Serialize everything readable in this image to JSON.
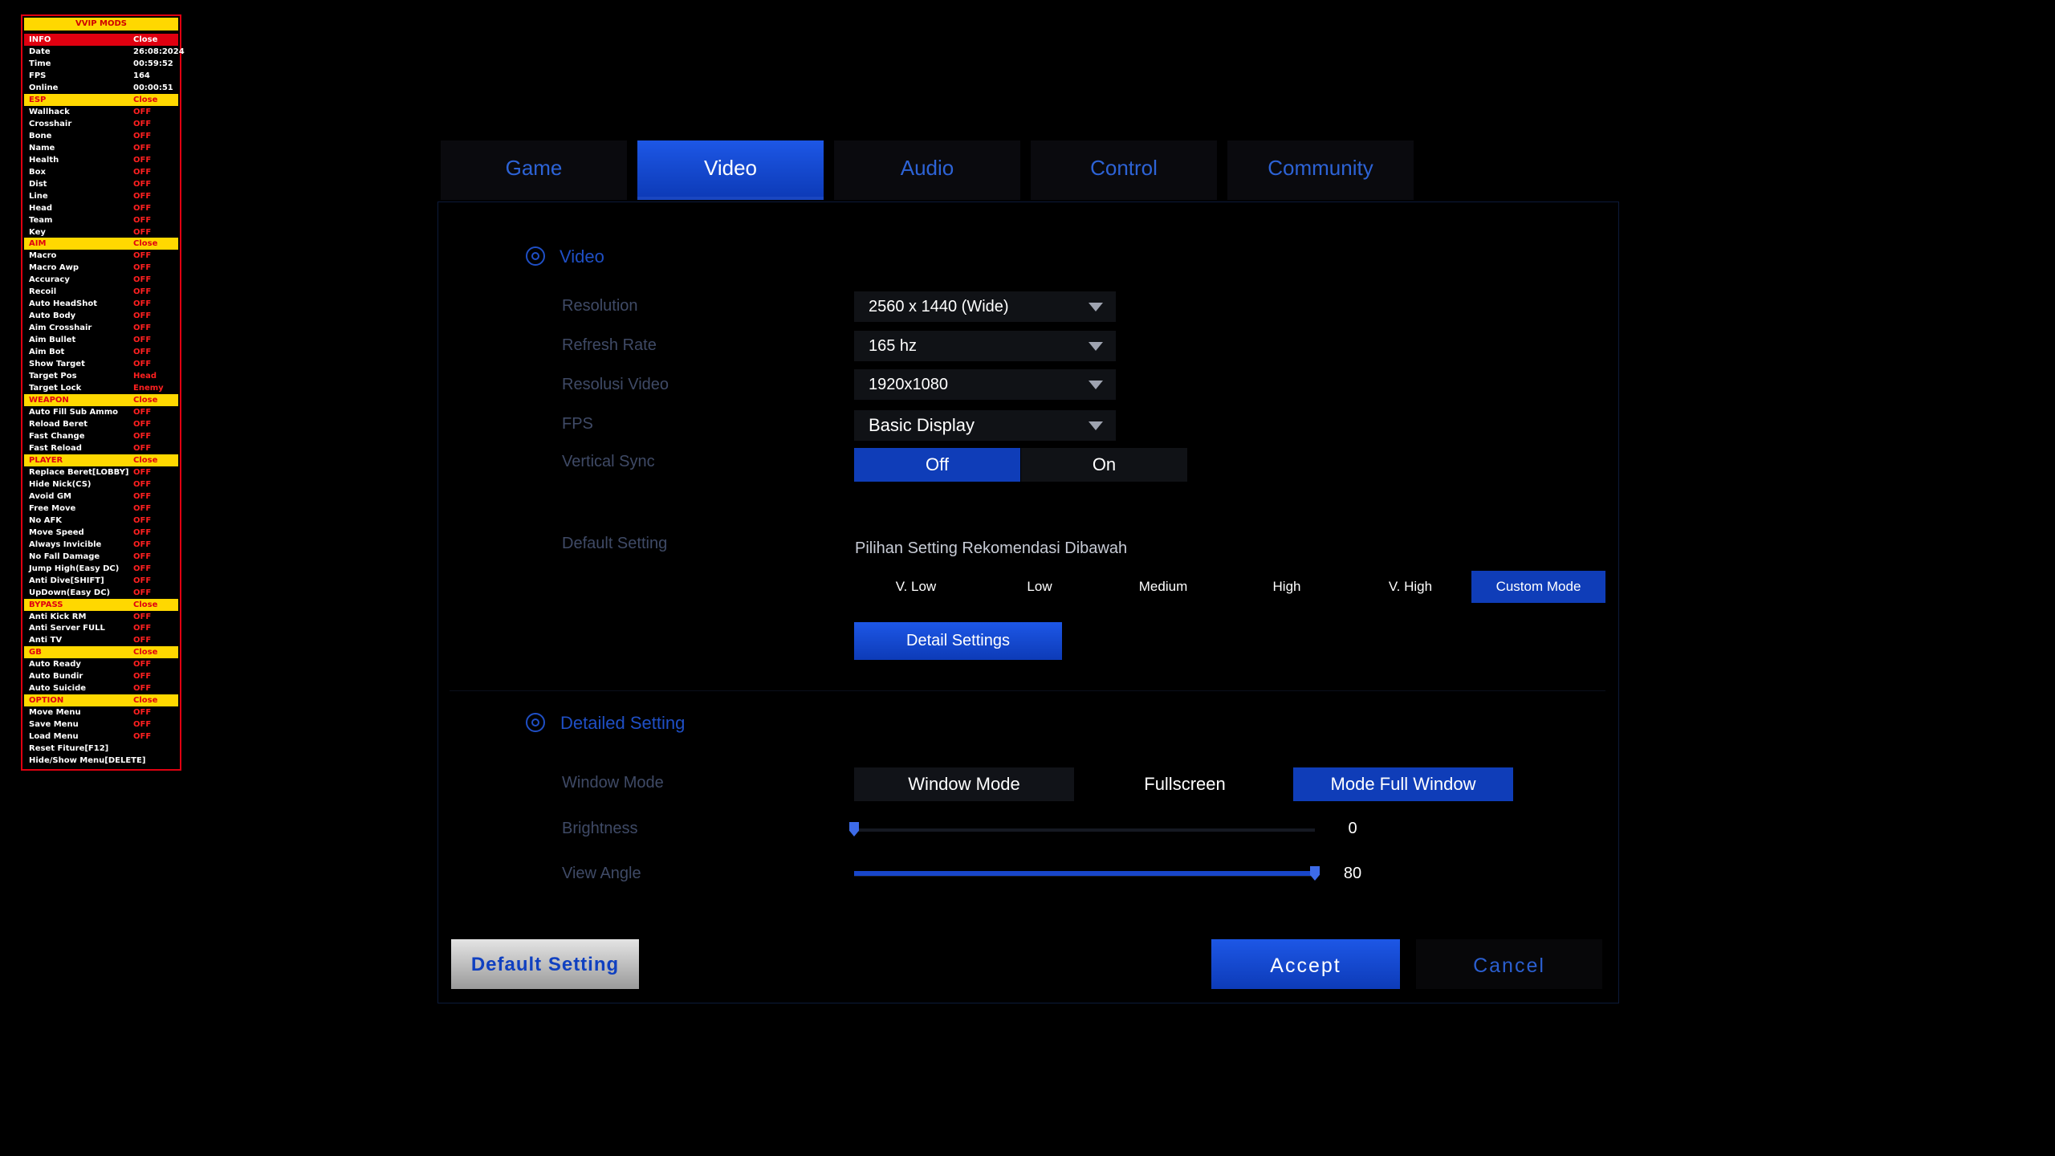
{
  "mod_menu": {
    "title": "VVIP MODS",
    "rows": [
      {
        "type": "info",
        "k": "INFO",
        "v": "Close"
      },
      {
        "type": "kv",
        "k": "Date",
        "v": "26:08:2024"
      },
      {
        "type": "kv",
        "k": "Time",
        "v": "00:59:52"
      },
      {
        "type": "kv",
        "k": "FPS",
        "v": "164"
      },
      {
        "type": "kv",
        "k": "Online",
        "v": "00:00:51"
      },
      {
        "type": "section",
        "k": "ESP",
        "v": "Close"
      },
      {
        "type": "item",
        "k": "Wallhack",
        "v": "OFF"
      },
      {
        "type": "item",
        "k": "Crosshair",
        "v": "OFF"
      },
      {
        "type": "item",
        "k": "Bone",
        "v": "OFF"
      },
      {
        "type": "item",
        "k": "Name",
        "v": "OFF"
      },
      {
        "type": "item",
        "k": "Health",
        "v": "OFF"
      },
      {
        "type": "item",
        "k": "Box",
        "v": "OFF"
      },
      {
        "type": "item",
        "k": "Dist",
        "v": "OFF"
      },
      {
        "type": "item",
        "k": "Line",
        "v": "OFF"
      },
      {
        "type": "item",
        "k": "Head",
        "v": "OFF"
      },
      {
        "type": "item",
        "k": "Team",
        "v": "OFF"
      },
      {
        "type": "item",
        "k": "Key",
        "v": "OFF"
      },
      {
        "type": "section",
        "k": "AIM",
        "v": "Close"
      },
      {
        "type": "item",
        "k": "Macro",
        "v": "OFF"
      },
      {
        "type": "item",
        "k": "Macro Awp",
        "v": "OFF"
      },
      {
        "type": "item",
        "k": "Accuracy",
        "v": "OFF"
      },
      {
        "type": "item",
        "k": "Recoil",
        "v": "OFF"
      },
      {
        "type": "item",
        "k": "Auto HeadShot",
        "v": "OFF"
      },
      {
        "type": "item",
        "k": "Auto Body",
        "v": "OFF"
      },
      {
        "type": "item",
        "k": "Aim Crosshair",
        "v": "OFF"
      },
      {
        "type": "item",
        "k": "Aim Bullet",
        "v": "OFF"
      },
      {
        "type": "item",
        "k": "Aim Bot",
        "v": "OFF"
      },
      {
        "type": "item",
        "k": "Show Target",
        "v": "OFF"
      },
      {
        "type": "item",
        "k": "Target Pos",
        "v": "Head"
      },
      {
        "type": "item",
        "k": "Target Lock",
        "v": "Enemy"
      },
      {
        "type": "section",
        "k": "WEAPON",
        "v": "Close"
      },
      {
        "type": "item",
        "k": "Auto Fill Sub Ammo",
        "v": "OFF"
      },
      {
        "type": "item",
        "k": "Reload Beret",
        "v": "OFF"
      },
      {
        "type": "item",
        "k": "Fast Change",
        "v": "OFF"
      },
      {
        "type": "item",
        "k": "Fast Reload",
        "v": "OFF"
      },
      {
        "type": "section",
        "k": "PLAYER",
        "v": "Close"
      },
      {
        "type": "item",
        "k": "Replace Beret[LOBBY]",
        "v": "OFF"
      },
      {
        "type": "item",
        "k": "Hide Nick(CS)",
        "v": "OFF"
      },
      {
        "type": "item",
        "k": "Avoid GM",
        "v": "OFF"
      },
      {
        "type": "item",
        "k": "Free Move",
        "v": "OFF"
      },
      {
        "type": "item",
        "k": "No AFK",
        "v": "OFF"
      },
      {
        "type": "item",
        "k": "Move Speed",
        "v": "OFF"
      },
      {
        "type": "item",
        "k": "Always Invicible",
        "v": "OFF"
      },
      {
        "type": "item",
        "k": "No Fall Damage",
        "v": "OFF"
      },
      {
        "type": "item",
        "k": "Jump High(Easy DC)",
        "v": "OFF"
      },
      {
        "type": "item",
        "k": "Anti Dive[SHIFT]",
        "v": "OFF"
      },
      {
        "type": "item",
        "k": "UpDown(Easy DC)",
        "v": "OFF"
      },
      {
        "type": "section",
        "k": "BYPASS",
        "v": "Close"
      },
      {
        "type": "item",
        "k": "Anti Kick RM",
        "v": "OFF"
      },
      {
        "type": "item",
        "k": "Anti Server FULL",
        "v": "OFF"
      },
      {
        "type": "item",
        "k": "Anti TV",
        "v": "OFF"
      },
      {
        "type": "section",
        "k": "GB",
        "v": "Close"
      },
      {
        "type": "item",
        "k": "Auto Ready",
        "v": "OFF"
      },
      {
        "type": "item",
        "k": "Auto Bundir",
        "v": "OFF"
      },
      {
        "type": "item",
        "k": "Auto Suicide",
        "v": "OFF"
      },
      {
        "type": "section",
        "k": "OPTION",
        "v": "Close"
      },
      {
        "type": "item",
        "k": "Move Menu",
        "v": "OFF"
      },
      {
        "type": "item",
        "k": "Save Menu",
        "v": "OFF"
      },
      {
        "type": "item",
        "k": "Load Menu",
        "v": "OFF"
      },
      {
        "type": "plain",
        "k": "Reset Fiture[F12]",
        "v": ""
      },
      {
        "type": "plain",
        "k": "Hide/Show Menu[DELETE]",
        "v": ""
      }
    ]
  },
  "tabs": [
    "Game",
    "Video",
    "Audio",
    "Control",
    "Community"
  ],
  "active_tab": "Video",
  "video": {
    "title": "Video",
    "resolution": {
      "label": "Resolution",
      "value": "2560 x 1440 (Wide)"
    },
    "refresh_rate": {
      "label": "Refresh Rate",
      "value": "165 hz"
    },
    "resolusi_video": {
      "label": "Resolusi Video",
      "value": "1920x1080"
    },
    "fps": {
      "label": "FPS",
      "value": "Basic Display"
    },
    "vsync": {
      "label": "Vertical Sync",
      "off": "Off",
      "on": "On",
      "selected": "Off"
    },
    "default_setting": {
      "label": "Default Setting",
      "hint": "Pilihan Setting Rekomendasi Dibawah",
      "presets": [
        "V. Low",
        "Low",
        "Medium",
        "High",
        "V. High",
        "Custom Mode"
      ],
      "selected": "Custom Mode",
      "detail_button": "Detail Settings"
    }
  },
  "detailed": {
    "title": "Detailed Setting",
    "window_mode": {
      "label": "Window Mode",
      "options": [
        "Window Mode",
        "Fullscreen",
        "Mode Full Window"
      ],
      "selected": "Mode Full Window"
    },
    "brightness": {
      "label": "Brightness",
      "value": 0,
      "value_text": "0",
      "max": 80
    },
    "view_angle": {
      "label": "View Angle",
      "value": 80,
      "value_text": "80",
      "max": 80
    }
  },
  "footer": {
    "default": "Default Setting",
    "accept": "Accept",
    "cancel": "Cancel"
  },
  "colors": {
    "accent": "#0f3db8",
    "menu_red": "#e00010",
    "menu_yellow": "#ffd800"
  }
}
